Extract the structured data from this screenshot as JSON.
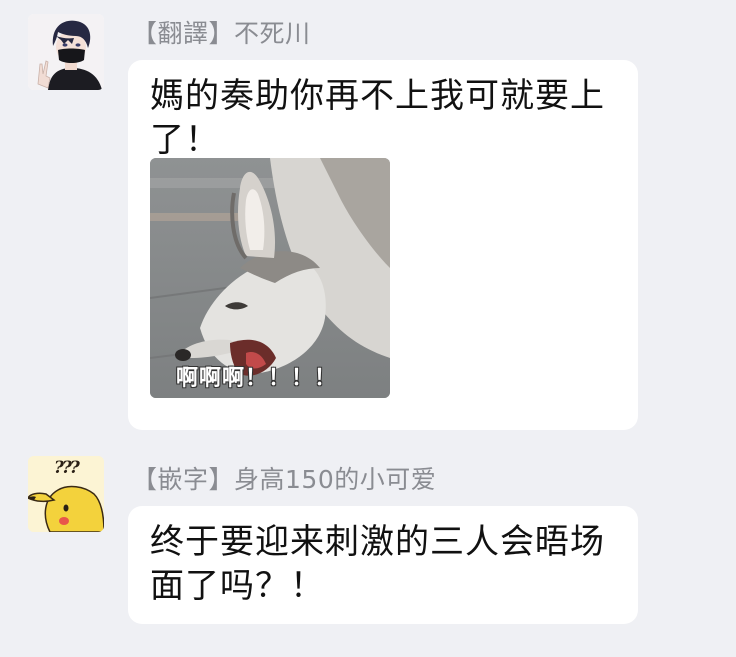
{
  "messages": [
    {
      "sender_tag": "【翻譯】",
      "sender_name": "不死川",
      "text": "媽的奏助你再不上我可就要上了！",
      "sticker_caption": "啊啊啊！！！！"
    },
    {
      "sender_tag": "【嵌字】",
      "sender_name": "身高150的小可爱",
      "text": "终于要迎来刺激的三人会晤场面了吗？！",
      "avatar_text": "???"
    }
  ],
  "colors": {
    "background": "#eff0f4",
    "bubble": "#ffffff",
    "sender_text": "#8a8c92",
    "message_text": "#111111",
    "pikachu_yellow": "#f3d23c"
  },
  "icons": {
    "avatar_1": "user-avatar-masked-boy",
    "avatar_2": "user-avatar-pikachu",
    "sticker": "husky-dog-yelling-sticker"
  }
}
